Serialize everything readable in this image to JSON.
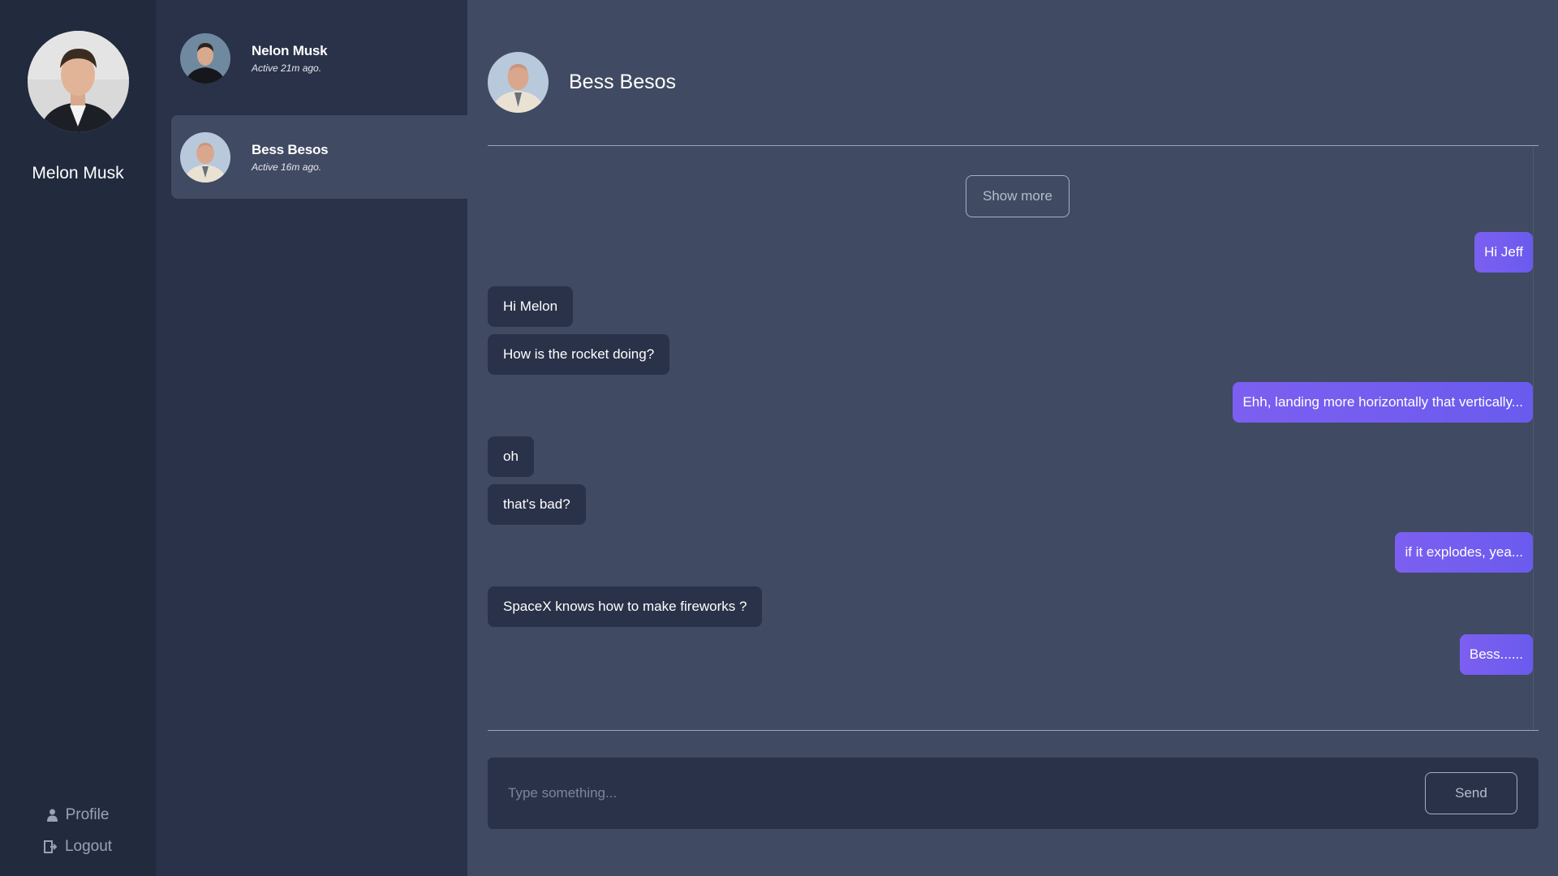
{
  "user": {
    "name": "Melon Musk",
    "avatar_icon": "user-portrait"
  },
  "rail_nav": {
    "profile_label": "Profile",
    "profile_icon": "person-icon",
    "logout_label": "Logout",
    "logout_icon": "logout-icon"
  },
  "conversations": [
    {
      "name": "Nelon Musk",
      "status": "Active 21m ago.",
      "selected": false
    },
    {
      "name": "Bess Besos",
      "status": "Active 16m ago.",
      "selected": true
    }
  ],
  "chat": {
    "title": "Bess Besos",
    "show_more_label": "Show more",
    "messages": [
      {
        "from": "me",
        "text": "Hi Jeff"
      },
      {
        "from": "them",
        "text": "Hi Melon"
      },
      {
        "from": "them",
        "text": "How is the rocket doing?"
      },
      {
        "from": "me",
        "text": "Ehh, landing more horizontally that vertically..."
      },
      {
        "from": "them",
        "text": "oh"
      },
      {
        "from": "them",
        "text": "that's bad?"
      },
      {
        "from": "me",
        "text": "if it explodes, yea..."
      },
      {
        "from": "them",
        "text": "SpaceX knows how to make fireworks ?"
      },
      {
        "from": "me",
        "text": "Bess......"
      }
    ]
  },
  "composer": {
    "placeholder": "Type something...",
    "value": "",
    "send_label": "Send"
  },
  "colors": {
    "rail_bg": "#222a3e",
    "list_bg": "#2a3249",
    "main_bg": "#404a62",
    "bubble_in": "#2a3249",
    "bubble_out": "#7c5ff0"
  }
}
